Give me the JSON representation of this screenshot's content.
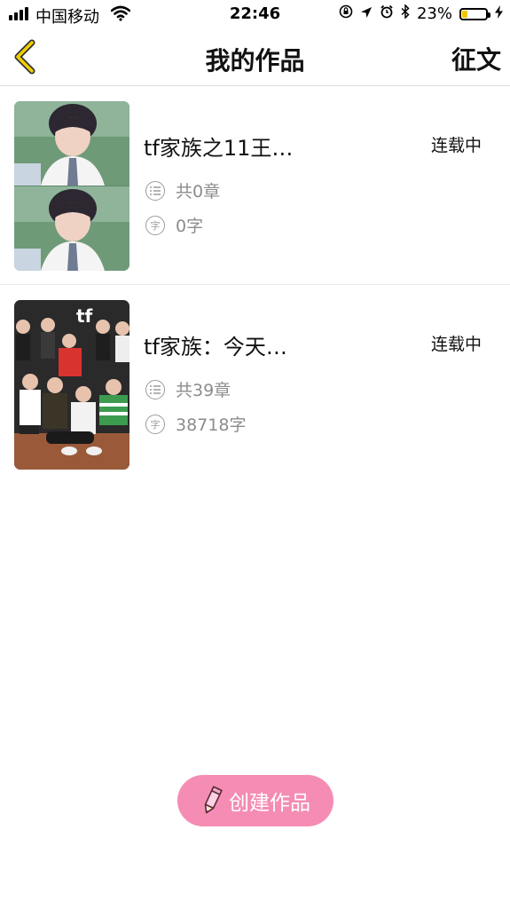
{
  "status_bar": {
    "carrier": "中国移动",
    "time": "22:46",
    "battery_percent": "23%",
    "battery_level": 0.23,
    "icons": [
      "signal-icon",
      "wifi-icon",
      "rotation-lock-icon",
      "location-icon",
      "alarm-icon",
      "bluetooth-icon",
      "battery-icon",
      "charging-icon"
    ]
  },
  "nav": {
    "title": "我的作品",
    "action_label": "征文",
    "back_icon": "chevron-left-icon",
    "accent_color": "#f0d000"
  },
  "works": [
    {
      "title": "tf家族之11王…",
      "status": "连载中",
      "chapters": "共0章",
      "words": "0字",
      "cover": "portrait-photo"
    },
    {
      "title": "tf家族：今天…",
      "status": "连载中",
      "chapters": "共39章",
      "words": "38718字",
      "cover": "group-photo"
    }
  ],
  "meta_icons": {
    "chapters": "list-icon",
    "words": "字",
    "words_icon_name": "word-count-icon"
  },
  "create_button": {
    "label": "创建作品",
    "icon": "pencil-icon",
    "color": "#f58cb4"
  }
}
